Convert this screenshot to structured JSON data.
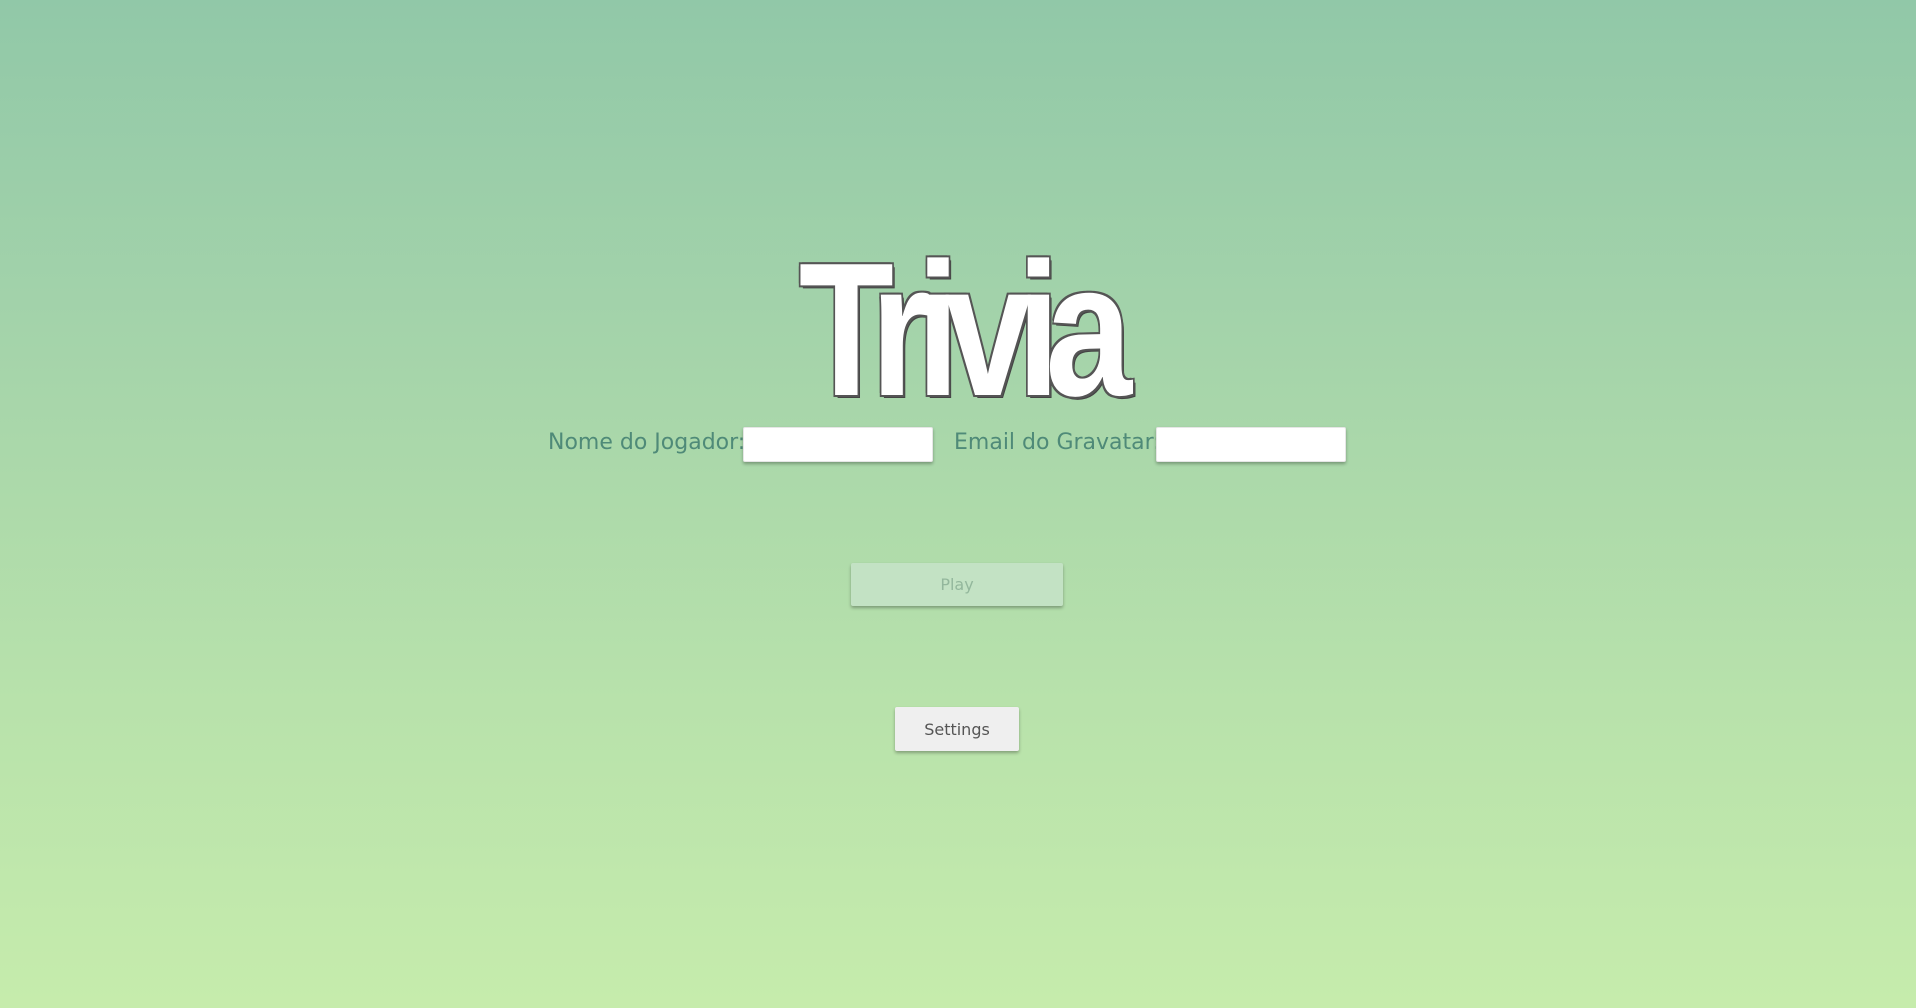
{
  "header": {
    "title": "Trivia"
  },
  "form": {
    "player_name_label": "Nome do Jogador:",
    "player_name_value": "",
    "gravatar_email_label": "Email do Gravatar:",
    "gravatar_email_value": ""
  },
  "actions": {
    "play_label": "Play",
    "play_enabled": false,
    "settings_label": "Settings"
  },
  "colors": {
    "background_top": "#91c8a8",
    "background_bottom": "#c6ecac",
    "label_text": "#4f8a78",
    "play_disabled_bg": "#c3e2c4",
    "settings_bg": "#efefef"
  }
}
